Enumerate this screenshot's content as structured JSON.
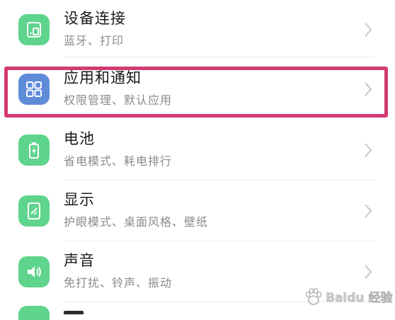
{
  "settings": {
    "items": [
      {
        "title": "设备连接",
        "subtitle": "蓝牙、打印",
        "icon": "device-connection-icon",
        "color": "#5fd48c"
      },
      {
        "title": "应用和通知",
        "subtitle": "权限管理、默认应用",
        "icon": "apps-grid-icon",
        "color": "#5f8bd9"
      },
      {
        "title": "电池",
        "subtitle": "省电模式、耗电排行",
        "icon": "battery-icon",
        "color": "#5fd48c"
      },
      {
        "title": "显示",
        "subtitle": "护眼模式、桌面风格、壁纸",
        "icon": "display-icon",
        "color": "#5fd48c"
      },
      {
        "title": "声音",
        "subtitle": "免打扰、铃声、振动",
        "icon": "sound-icon",
        "color": "#5fd48c"
      }
    ]
  },
  "watermark": {
    "text": "Baidu 经验"
  },
  "colors": {
    "highlight": "#d33a73",
    "divider": "#e9e9e9",
    "chevron": "#c8c8c8"
  }
}
